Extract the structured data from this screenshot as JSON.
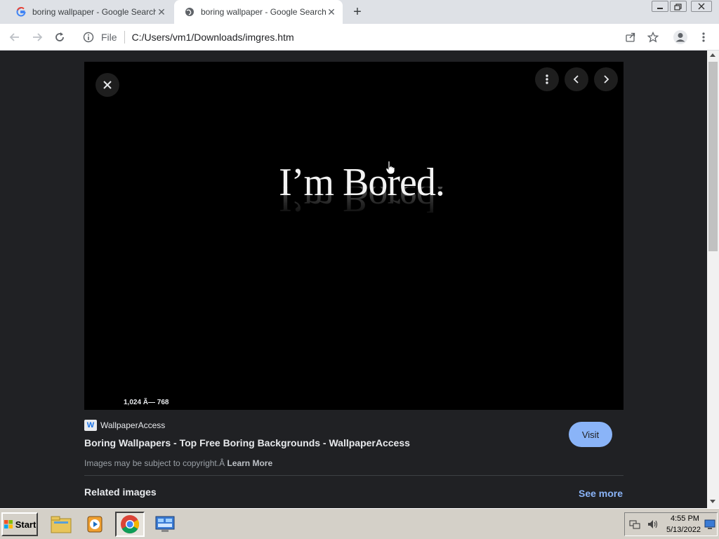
{
  "tabs": [
    {
      "title": "boring wallpaper - Google Search",
      "favicon": "google-g-icon",
      "active": false
    },
    {
      "title": "boring wallpaper - Google Search",
      "favicon": "globe-icon",
      "active": true
    }
  ],
  "toolbar": {
    "scheme": "File",
    "url": "C:/Users/vm1/Downloads/imgres.htm"
  },
  "viewer": {
    "image_text": "I’m Bored.",
    "dimensions": "1,024 Ã— 768"
  },
  "result": {
    "source": "WallpaperAccess",
    "source_logo": "W",
    "title": "Boring Wallpapers - Top Free Boring Backgrounds - WallpaperAccess",
    "visit_label": "Visit",
    "copyright": "Images may be subject to copyright.Â ",
    "learn_more": "Learn More",
    "related_label": "Related images",
    "see_more": "See more"
  },
  "taskbar": {
    "start_label": "Start",
    "time": "4:55 PM",
    "date": "5/13/2022"
  },
  "colors": {
    "page_bg": "#202124",
    "accent": "#8ab4f8",
    "tabstrip": "#dee1e6"
  }
}
